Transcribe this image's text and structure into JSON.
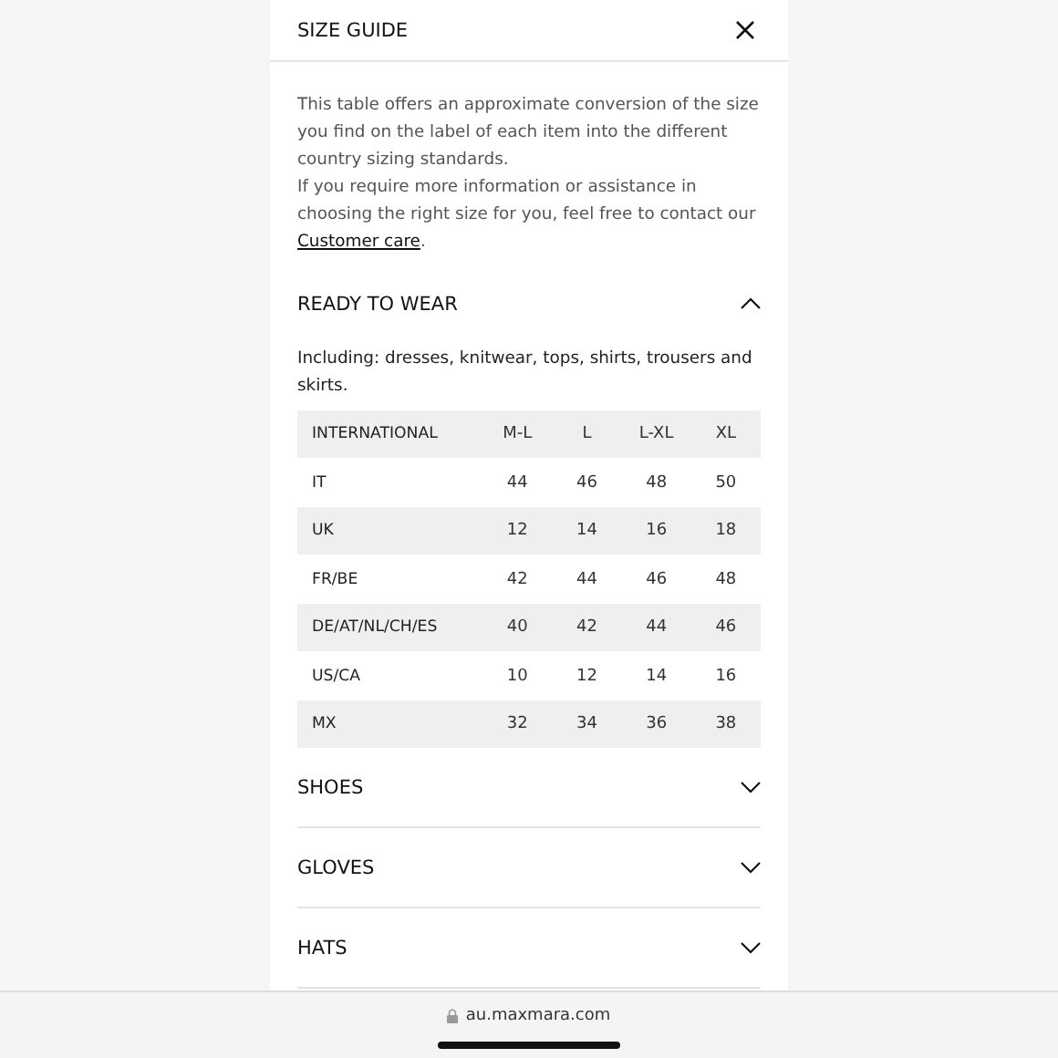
{
  "dialog": {
    "title": "SIZE GUIDE",
    "intro": "This table offers an approximate conversion of the size you find on the label of each item into the different country sizing standards.",
    "intro_2": "If you require more information or assistance in choosing the right size for you, feel free to contact our",
    "link": "Customer care",
    "link_suffix": "."
  },
  "sections": [
    {
      "title": "READY TO WEAR",
      "expanded": true,
      "note": "Including: dresses, knitwear, tops, shirts, trousers and skirts.",
      "table": {
        "columns": [
          "INTERNATIONAL",
          "M-L",
          "L",
          "L-XL",
          "XL"
        ],
        "rows": [
          [
            "IT",
            "44",
            "46",
            "48",
            "50"
          ],
          [
            "UK",
            "12",
            "14",
            "16",
            "18"
          ],
          [
            "FR/BE",
            "42",
            "44",
            "46",
            "48"
          ],
          [
            "DE/AT/NL/CH/ES",
            "40",
            "42",
            "44",
            "46"
          ],
          [
            "US/CA",
            "10",
            "12",
            "14",
            "16"
          ],
          [
            "MX",
            "32",
            "34",
            "36",
            "38"
          ]
        ]
      }
    },
    {
      "title": "SHOES",
      "expanded": false
    },
    {
      "title": "GLOVES",
      "expanded": false
    },
    {
      "title": "HATS",
      "expanded": false
    }
  ],
  "browser": {
    "url": "au.maxmara.com"
  }
}
